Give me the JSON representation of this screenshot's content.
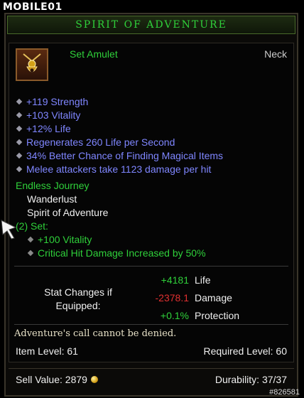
{
  "watermark": {
    "top": "MOBILE01",
    "bottom": "#826581"
  },
  "header": {
    "title": "SPIRIT OF ADVENTURE"
  },
  "item": {
    "type": "Set Amulet",
    "slot": "Neck",
    "icon": "amulet-icon"
  },
  "stats": [
    "+119 Strength",
    "+103 Vitality",
    "+12% Life",
    "Regenerates 260 Life per Second",
    "34% Better Chance of Finding Magical Items",
    "Melee attackers take 1123 damage per hit"
  ],
  "set": {
    "name": "Endless Journey",
    "pieces": [
      "Wanderlust",
      "Spirit of Adventure"
    ],
    "bonus_header": "(2) Set:",
    "bonuses": [
      "+100 Vitality",
      "Critical Hit Damage Increased by 50%"
    ]
  },
  "stat_changes": {
    "label": "Stat Changes if Equipped:",
    "rows": [
      {
        "value": "+4181",
        "name": "Life",
        "color": "#2fd03a"
      },
      {
        "value": "-2378.1",
        "name": "Damage",
        "color": "#e03030"
      },
      {
        "value": "+0.1%",
        "name": "Protection",
        "color": "#2fd03a"
      }
    ]
  },
  "flavor": "Adventure's call cannot be denied.",
  "item_level": "Item Level: 61",
  "required_level": "Required Level: 60",
  "sell_value": "Sell Value: 2879",
  "durability": "Durability: 37/37",
  "colors": {
    "set_green": "#2fd03a",
    "magic_blue": "#7f86ff"
  }
}
